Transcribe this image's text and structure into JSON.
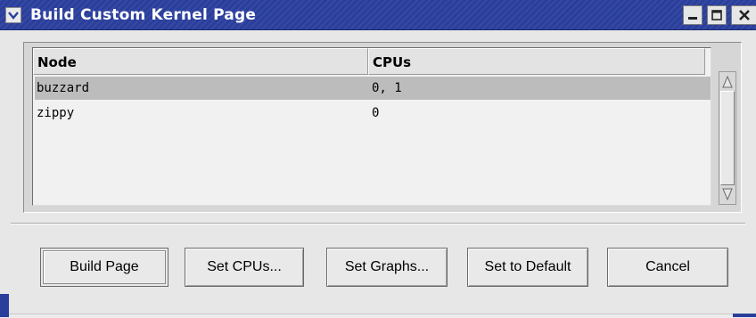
{
  "window": {
    "title": "Build Custom Kernel Page"
  },
  "table": {
    "columns": [
      "Node",
      "CPUs"
    ],
    "rows": [
      {
        "node": "buzzard",
        "cpus": "0, 1",
        "selected": true
      },
      {
        "node": "zippy",
        "cpus": "0",
        "selected": false
      }
    ]
  },
  "buttons": {
    "build_page": "Build Page",
    "set_cpus": "Set CPUs...",
    "set_graphs": "Set Graphs...",
    "set_default": "Set to Default",
    "cancel": "Cancel"
  },
  "colors": {
    "titlebar": "#2a3e9c",
    "selected_row": "#bcbcbc"
  },
  "icons": {
    "window_menu": "chevron-down-icon",
    "minimize": "minimize-icon",
    "maximize": "maximize-icon",
    "close": "close-icon",
    "scroll_up": "arrow-up-icon",
    "scroll_down": "arrow-down-icon"
  }
}
